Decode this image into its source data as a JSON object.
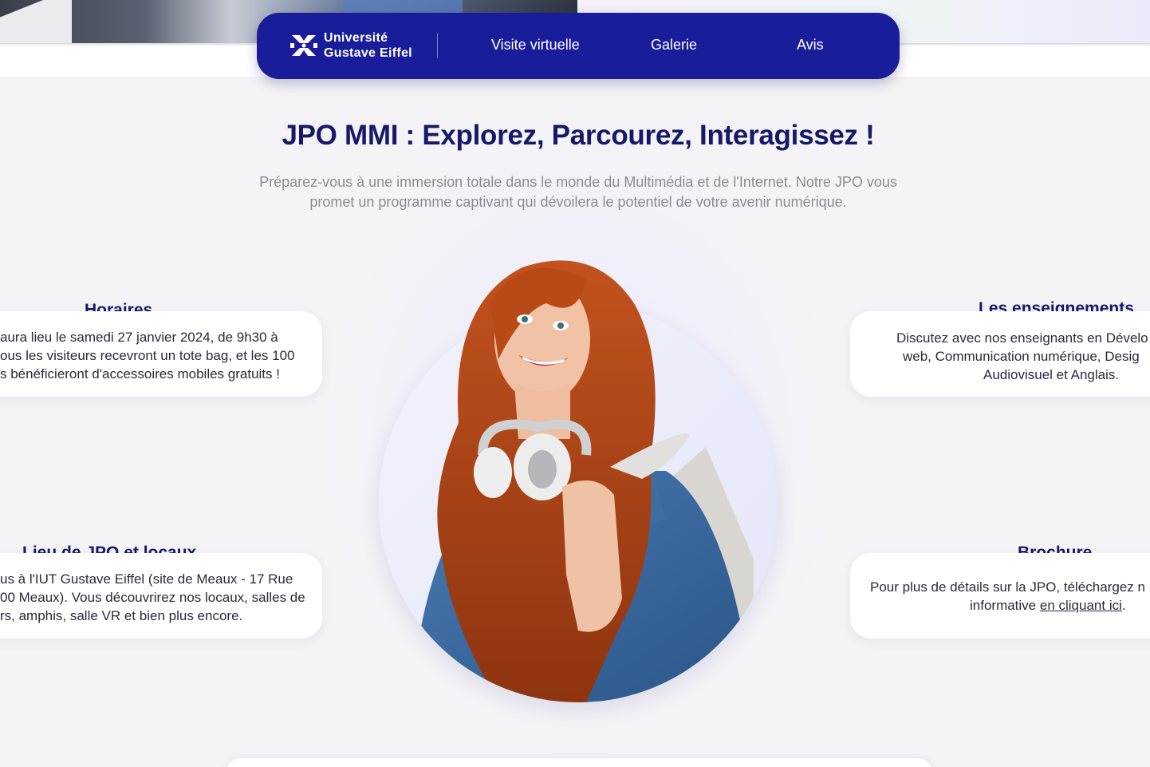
{
  "navbar": {
    "logo_line1": "Université",
    "logo_line2": "Gustave Eiffel",
    "links": [
      "Visite virtuelle",
      "Galerie",
      "Avis"
    ]
  },
  "hero": {
    "title": "JPO MMI : Explorez, Parcourez, Interagissez !",
    "subtitle_line1": "Préparez-vous à une immersion totale dans le monde du Multimédia et de l'Internet. Notre JPO vous",
    "subtitle_line2": "promet un programme captivant qui dévoilera le potentiel de votre avenir numérique."
  },
  "cards": {
    "horaires": {
      "title": "Horaires",
      "lines": [
        "aura lieu le samedi 27 janvier 2024, de 9h30 à",
        "ous les visiteurs recevront un tote bag, et les 100",
        "s bénéficieront d'accessoires mobiles gratuits !"
      ]
    },
    "lieu": {
      "title": "Lieu de JPO et locaux",
      "lines": [
        "us à l'IUT Gustave Eiffel (site de Meaux - 17 Rue",
        "00 Meaux). Vous découvrirez nos locaux, salles de",
        "rs, amphis, salle VR et bien plus encore."
      ]
    },
    "enseignements": {
      "title": "Les enseignements",
      "lines": [
        "Discutez avec nos enseignants en Dévelo",
        "web, Communication numérique, Desig",
        "Audiovisuel et Anglais."
      ]
    },
    "brochure": {
      "title": "Brochure",
      "line1": "Pour plus de détails sur la JPO, téléchargez n",
      "line2_prefix": "informative ",
      "link_text": "en cliquant ici",
      "line2_suffix": "."
    }
  },
  "colors": {
    "navy": "#1a1d9a",
    "title": "#17186a",
    "background": "#f4f4f6"
  }
}
